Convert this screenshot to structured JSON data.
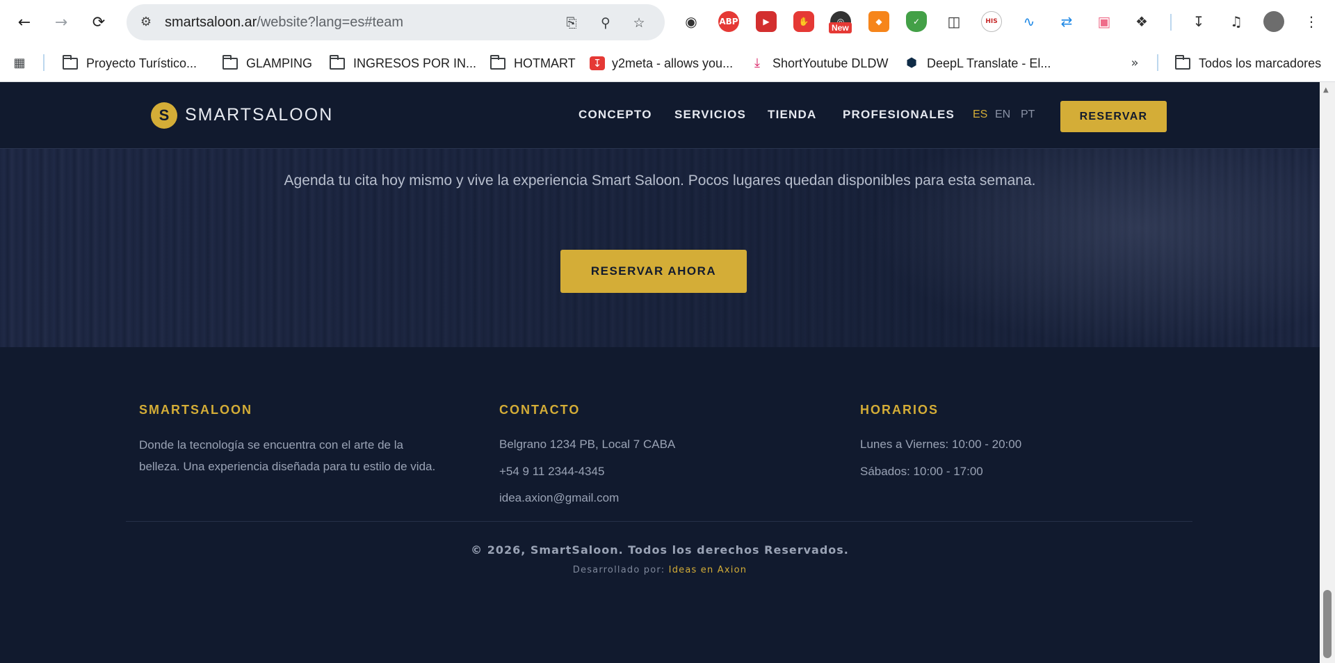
{
  "browser": {
    "url_domain": "smartsaloon.ar",
    "url_path": "/website?lang=es#team",
    "new_badge": "New",
    "extensions": {
      "abp": "ABP",
      "his": "HIS"
    },
    "bookmarks": [
      {
        "label": "Proyecto Turístico...",
        "icon": "folder-icon"
      },
      {
        "label": "GLAMPING",
        "icon": "folder-icon"
      },
      {
        "label": "INGRESOS POR IN...",
        "icon": "folder-icon"
      },
      {
        "label": "HOTMART",
        "icon": "folder-icon"
      },
      {
        "label": "y2meta - allows you...",
        "icon": "download-icon"
      },
      {
        "label": "ShortYoutube DLDW",
        "icon": "download-icon"
      },
      {
        "label": "DeepL Translate - El...",
        "icon": "deepl-icon"
      }
    ],
    "all_bookmarks": "Todos los marcadores"
  },
  "site": {
    "logo_letter": "S",
    "logo_text": "SMARTSALOON",
    "nav": [
      "CONCEPTO",
      "SERVICIOS",
      "TIENDA",
      "PROFESIONALES"
    ],
    "langs": [
      "ES",
      "EN",
      "PT"
    ],
    "active_lang": "ES",
    "reserve_label": "RESERVAR",
    "hero_text": "Agenda tu cita hoy mismo y vive la experiencia Smart Saloon. Pocos lugares quedan disponibles para esta semana.",
    "hero_button": "RESERVAR AHORA",
    "footer": {
      "col1_title": "SMARTSALOON",
      "col1_line1": "Donde la tecnología se encuentra con el arte de la",
      "col1_line2": "belleza. Una experiencia diseñada para tu estilo de vida.",
      "col2_title": "CONTACTO",
      "address": "Belgrano 1234 PB, Local 7 CABA",
      "phone": "+54 9 11 2344-4345",
      "email": "idea.axion@gmail.com",
      "col3_title": "HORARIOS",
      "weekday_hours": "Lunes a Viernes: 10:00 - 20:00",
      "saturday_hours": "Sábados: 10:00 - 17:00",
      "copyright": "© 2026, SmartSaloon. Todos los derechos Reservados.",
      "dev_prefix": "Desarrollado por:",
      "dev_link": "Ideas en Axion"
    }
  },
  "colors": {
    "accent": "#d4ad37",
    "background": "#111a2e"
  }
}
